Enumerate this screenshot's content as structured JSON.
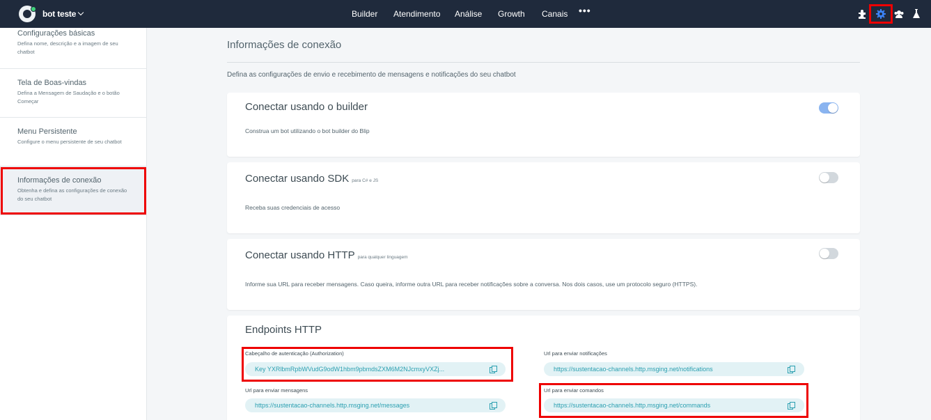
{
  "header": {
    "bot_name": "bot teste",
    "nav": [
      "Builder",
      "Atendimento",
      "Análise",
      "Growth",
      "Canais"
    ],
    "more": "•••",
    "icons": [
      "puzzle-icon",
      "gear-icon",
      "team-icon",
      "flask-icon"
    ],
    "active_icon_color": "#3b82f6"
  },
  "sidebar": {
    "items": [
      {
        "title": "Configurações básicas",
        "desc": "Defina nome, descrição e a imagem de seu chatbot"
      },
      {
        "title": "Tela de Boas-vindas",
        "desc": "Defina a Mensagem de Saudação e o botão Começar"
      },
      {
        "title": "Menu Persistente",
        "desc": "Configure o menu persistente de seu chatbot"
      },
      {
        "title": "Informações de conexão",
        "desc": "Obtenha e defina as configurações de conexão do seu chatbot"
      }
    ]
  },
  "main": {
    "title": "Informações de conexão",
    "desc": "Defina as configurações de envio e recebimento de mensagens e notificações do seu chatbot",
    "cards": [
      {
        "title": "Conectar usando o builder",
        "note": "",
        "desc": "Construa um bot utilizando o bot builder do Blip",
        "enabled": true
      },
      {
        "title": "Conectar usando SDK",
        "note": "para C# e JS",
        "desc": "Receba suas credenciais de acesso",
        "enabled": false
      },
      {
        "title": "Conectar usando HTTP",
        "note": "para qualquer linguagem",
        "desc": "Informe sua URL para receber mensagens. Caso queira, informe outra URL para receber notificações sobre a conversa. Nos dois casos, use um protocolo seguro (HTTPS).",
        "enabled": false
      }
    ],
    "endpoints": {
      "title": "Endpoints HTTP",
      "auth_label": "Cabeçalho de autenticação (Authorization)",
      "auth_value": "Key YXRlbmRpbWVudG9odW1hbm9pbmdsZXM6M2NJcmxyVXZj...",
      "notif_label": "Url para enviar notificações",
      "notif_value": "https://sustentacao-channels.http.msging.net/notifications",
      "msg_label": "Url para enviar mensagens",
      "msg_value": "https://sustentacao-channels.http.msging.net/messages",
      "cmd_label": "Url para enviar comandos",
      "cmd_value": "https://sustentacao-channels.http.msging.net/commands"
    }
  }
}
